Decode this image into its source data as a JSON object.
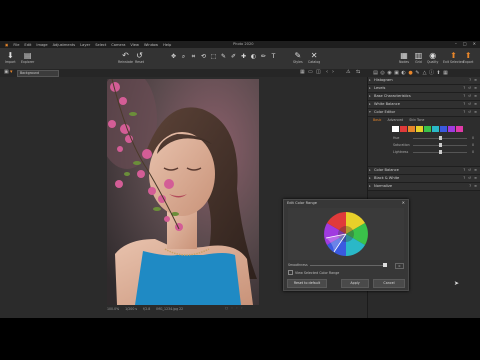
{
  "window": {
    "title": "Photo 2020"
  },
  "menu": [
    "File",
    "Edit",
    "Image",
    "Adjustments",
    "Layer",
    "Select",
    "Camera",
    "View",
    "Window",
    "Help"
  ],
  "toolbar": {
    "left": [
      {
        "label": "Import",
        "icon": "import-icon"
      },
      {
        "label": "Explorer",
        "icon": "explorer-icon"
      }
    ],
    "history": [
      {
        "label": "Reinstate",
        "icon": "undo-icon"
      },
      {
        "label": "Reset",
        "icon": "reset-icon"
      }
    ],
    "cursor_tools_label": "Cursor Tools",
    "center_right": [
      {
        "label": "Styles",
        "icon": "styles-icon"
      },
      {
        "label": "Catalog",
        "icon": "catalog-icon"
      }
    ],
    "right": [
      {
        "label": "Nodes",
        "icon": "nodes-icon"
      },
      {
        "label": "Grid",
        "icon": "grid-icon"
      },
      {
        "label": "Quality",
        "icon": "quality-icon"
      },
      {
        "label": "Exit Selected",
        "icon": "exit-icon"
      },
      {
        "label": "Export",
        "icon": "export-icon"
      }
    ]
  },
  "viewer": {
    "tab_label": "Background",
    "status": {
      "zoom": "100.0%",
      "iso": "1/200 s",
      "aperture": "f/2.8",
      "filename": "IMG_1234.jpg 22"
    }
  },
  "panel": {
    "tools": [
      {
        "label": "Histogram"
      },
      {
        "label": "Levels"
      },
      {
        "label": "Base Characteristics"
      },
      {
        "label": "White Balance"
      },
      {
        "label": "Color Editor"
      }
    ],
    "color_editor": {
      "tabs": [
        "Basic",
        "Advanced",
        "Skin Tone"
      ],
      "swatches": [
        "#ffffff",
        "#e03a3a",
        "#e8862a",
        "#e8d02a",
        "#3ac24a",
        "#2ab8c8",
        "#3a5ae0",
        "#a03ae0",
        "#e03aa8"
      ],
      "sliders": [
        {
          "label": "Hue",
          "value": "0",
          "fraction": 0.5
        },
        {
          "label": "Saturation",
          "value": "0",
          "fraction": 0.5
        },
        {
          "label": "Lightness",
          "value": "0",
          "fraction": 0.5
        }
      ]
    },
    "tools_after": [
      {
        "label": "Color Balance"
      },
      {
        "label": "Black & White"
      },
      {
        "label": "Normalize"
      }
    ]
  },
  "dialog": {
    "title": "Edit Color Range",
    "smoothness_label": "Smoothness",
    "smoothness_value": "0",
    "checkbox_label": "View Selected Color Range",
    "buttons": {
      "reset": "Reset to default",
      "apply": "Apply",
      "cancel": "Cancel"
    }
  }
}
